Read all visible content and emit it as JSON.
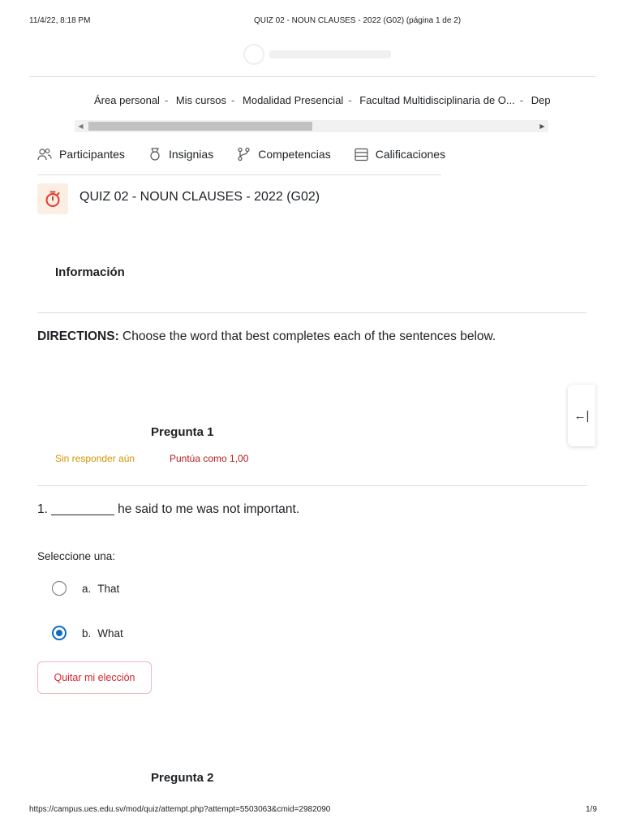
{
  "print_header": {
    "datetime": "11/4/22, 8:18 PM",
    "doc_title": "QUIZ 02 - NOUN CLAUSES - 2022 (G02) (página 1 de 2)"
  },
  "print_footer": {
    "url": "https://campus.ues.edu.sv/mod/quiz/attempt.php?attempt=5503063&cmid=2982090",
    "page": "1/9"
  },
  "breadcrumb": {
    "items": [
      "Área personal",
      "Mis cursos",
      "Modalidad Presencial",
      "Facultad Multidisciplinaria de O...",
      "Depc"
    ],
    "separator": "-"
  },
  "secondary_nav": {
    "items": [
      {
        "label": "Participantes",
        "icon": "users-icon"
      },
      {
        "label": "Insignias",
        "icon": "badge-icon"
      },
      {
        "label": "Competencias",
        "icon": "competencies-icon"
      },
      {
        "label": "Calificaciones",
        "icon": "grades-icon"
      }
    ]
  },
  "quiz": {
    "title": "QUIZ 02 - NOUN CLAUSES - 2022 (G02)",
    "icon": "stopwatch-icon",
    "accent_color": "#e03b2e"
  },
  "info": {
    "heading": "Información",
    "directions_label": "DIRECTIONS:",
    "directions_text": " Choose the word that best completes each of the sentences below."
  },
  "drawer": {
    "toggle_glyph": "←|"
  },
  "question1": {
    "heading": "Pregunta 1",
    "status": "Sin responder aún",
    "grade": "Puntúa como 1,00",
    "text": "1. _________ he said to me was not important.",
    "prompt": "Seleccione una:",
    "options": [
      {
        "letter": "a.",
        "label": "That",
        "checked": false
      },
      {
        "letter": "b.",
        "label": "What",
        "checked": true
      }
    ],
    "clear_label": "Quitar mi elección"
  },
  "question2": {
    "heading": "Pregunta 2"
  },
  "colors": {
    "status": "#d19500",
    "grade": "#b31e1e",
    "radio_checked": "#0f6cbf",
    "clear_button": "#d6232f"
  }
}
